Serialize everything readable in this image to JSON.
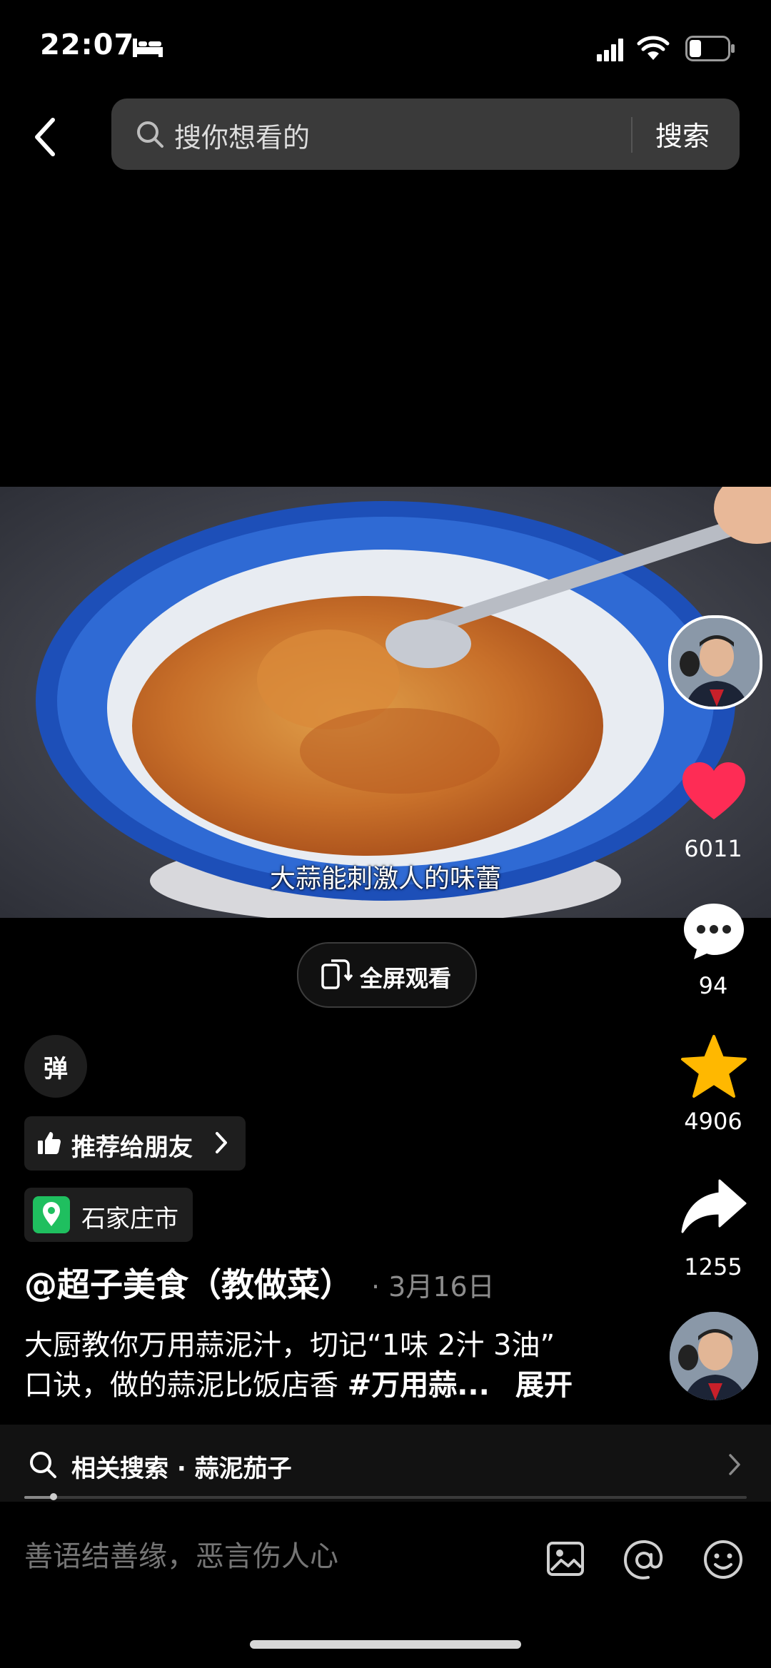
{
  "status": {
    "time": "22:07"
  },
  "search": {
    "placeholder": "搜你想看的",
    "button": "搜索"
  },
  "video": {
    "subtitle": "大蒜能刺激人的味蕾"
  },
  "fullscreen": {
    "label": "全屏观看"
  },
  "actions": {
    "likes": "6011",
    "comments": "94",
    "favorites": "4906",
    "shares": "1255"
  },
  "info": {
    "danmu": "弹",
    "recommend": "推荐给朋友",
    "location": "石家庄市",
    "author": "@超子美食（教做菜）",
    "date": "· 3月16日",
    "desc_line1": "大厨教你万用蒜泥汁，切记“1味 2汁 3油”",
    "desc_line2": "口诀，做的蒜泥比饭店香 ",
    "desc_tag": "#万用蒜...",
    "expand": "展开"
  },
  "related": {
    "label": "相关搜索 · 蒜泥茄子",
    "progress": 0.04
  },
  "comment": {
    "placeholder": "善语结善缘，恶言伤人心"
  },
  "colors": {
    "like": "#fe2c55",
    "star": "#ffb800",
    "location": "#1fbf5f"
  }
}
